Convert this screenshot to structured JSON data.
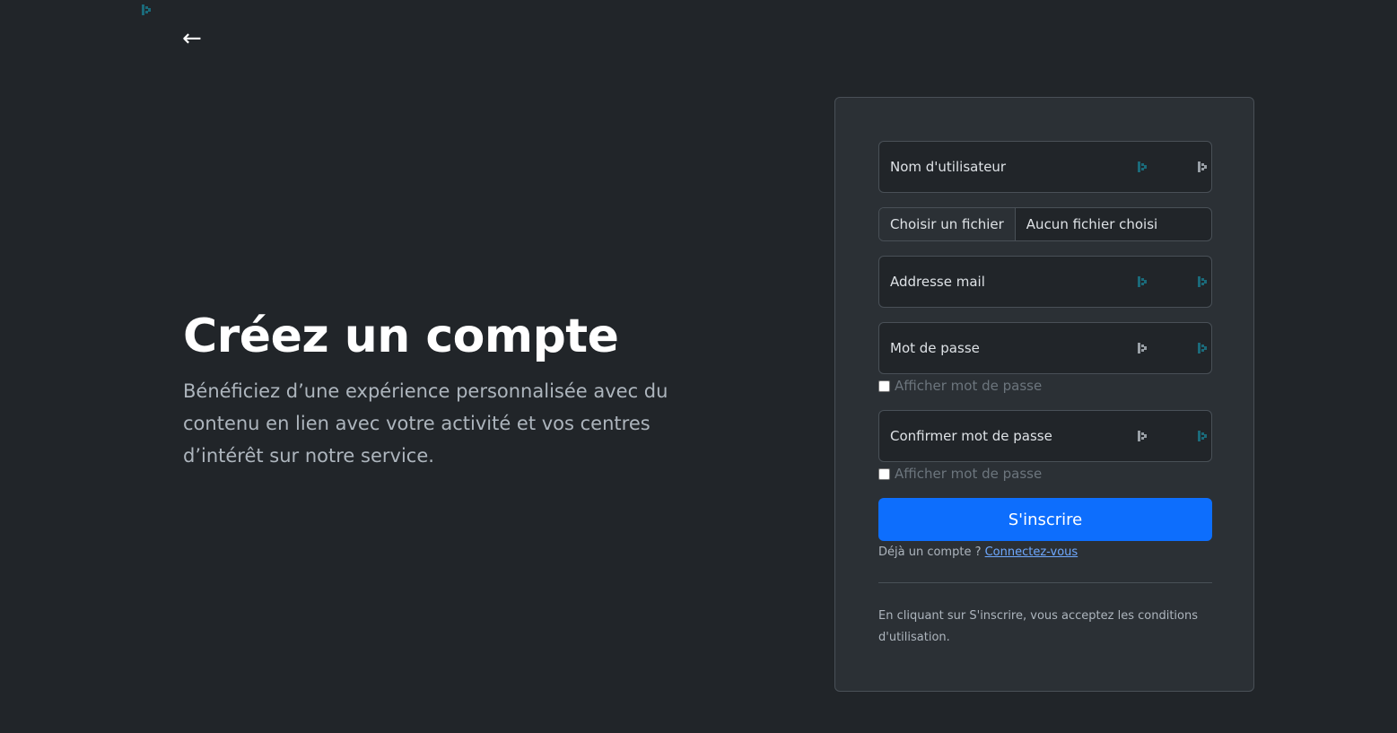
{
  "nav": {
    "back_arrow": "←"
  },
  "hero": {
    "title": "Créez un compte",
    "subtitle": "Bénéficiez d’une expérience personnalisée avec du contenu en lien avec votre activité et vos centres d’intérêt sur notre service."
  },
  "form": {
    "username_label": "Nom d'utilisateur",
    "username_value": "",
    "file_button_label": "Choisir un fichier",
    "file_status": "Aucun fichier choisi",
    "email_label": "Addresse mail",
    "email_value": "",
    "password_label": "Mot de passe",
    "password_value": "",
    "show_password_label": "Afficher mot de passe",
    "confirm_password_label": "Confirmer mot de passe",
    "confirm_password_value": "",
    "show_confirm_password_label": "Afficher mot de passe",
    "submit_label": "S'inscrire",
    "has_account_text": "Déjà un compte ? ",
    "login_link_label": "Connectez-vous",
    "terms_text": "En cliquant sur S'inscrire, vous acceptez les conditions d'utilisation."
  },
  "icons": {
    "extension_icon_color": "#1a6a7a",
    "extension_icon_alt_color": "#9aa0a6"
  },
  "colors": {
    "background": "#212529",
    "card": "#2b3035",
    "primary": "#0d6efd",
    "link": "#6ea8fe"
  }
}
